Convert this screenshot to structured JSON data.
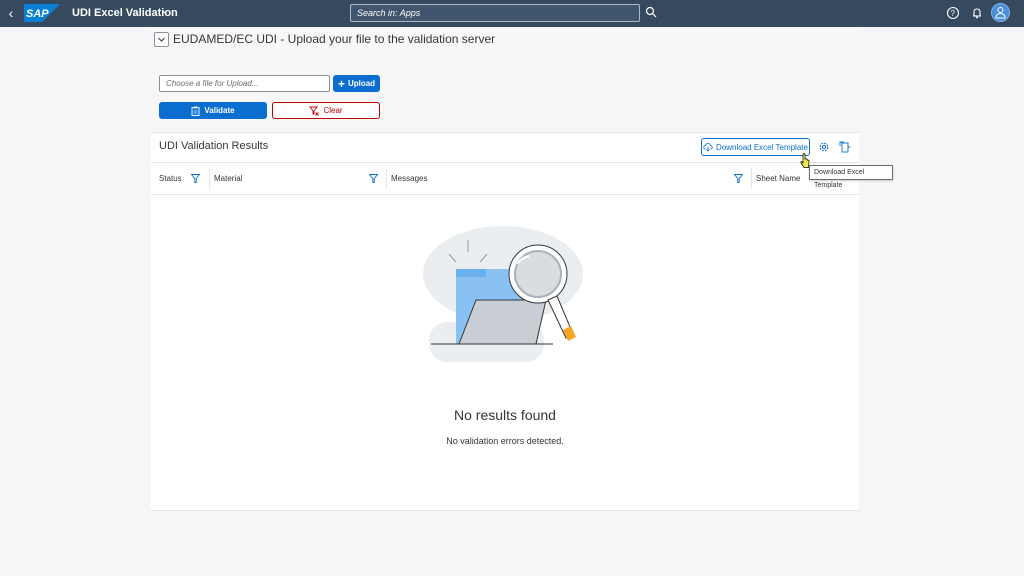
{
  "shell": {
    "logo": "SAP",
    "app_title": "UDI Excel Validation",
    "search_placeholder": "Search in: Apps",
    "icons": [
      "back-icon",
      "chevron-down-icon",
      "search-icon",
      "help-icon",
      "bell-icon",
      "user-icon"
    ]
  },
  "page": {
    "title": "EUDAMED/EC UDI - Upload your file to the validation server",
    "file_placeholder": "Choose a file for Upload...",
    "upload_label": "Upload",
    "validate_label": "Validate",
    "clear_label": "Clear"
  },
  "results": {
    "title": "UDI Validation Results",
    "download_label": "Download Excel Template",
    "columns": [
      "Status",
      "Material",
      "Messages",
      "Sheet Name"
    ],
    "empty_title": "No results found",
    "empty_subtitle": "No validation errors detected."
  },
  "tooltip": "Download Excel Template",
  "colors": {
    "shell": "#354a5f",
    "accent": "#0a6ed1",
    "negative": "#bb0000",
    "illustration_highlight": "#f5a623"
  }
}
